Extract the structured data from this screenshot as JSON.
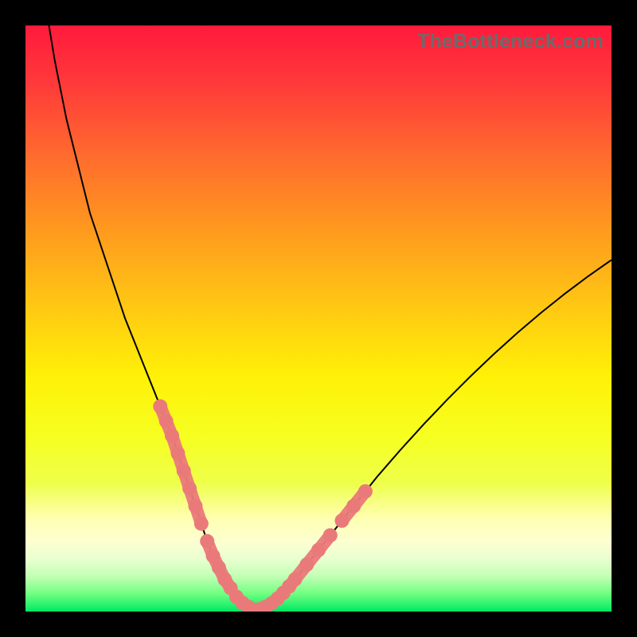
{
  "watermark_text": "TheBottleneck.com",
  "chart_data": {
    "type": "line",
    "title": "",
    "xlabel": "",
    "ylabel": "",
    "xlim": [
      0,
      100
    ],
    "ylim": [
      0,
      100
    ],
    "series": [
      {
        "name": "left_curve",
        "x": [
          4,
          5,
          6,
          7,
          8,
          9,
          10,
          11,
          12,
          13,
          14,
          15,
          16,
          17,
          18,
          19,
          20,
          21,
          22,
          23,
          24,
          25,
          26,
          27,
          28,
          29,
          30,
          31,
          32,
          33,
          34,
          35,
          36,
          37,
          38,
          39
        ],
        "y": [
          100,
          94,
          89,
          84,
          80,
          76,
          72,
          68,
          65,
          62,
          59,
          56,
          53,
          50,
          47.5,
          45,
          42.5,
          40,
          37.5,
          35,
          32.5,
          30,
          27,
          24,
          21,
          18,
          15,
          12,
          9.5,
          7.5,
          5.5,
          4,
          2.5,
          1.5,
          0.8,
          0.3
        ]
      },
      {
        "name": "right_curve",
        "x": [
          39,
          40,
          41,
          42,
          43,
          44,
          45,
          46,
          48,
          50,
          52,
          54,
          56,
          58,
          60,
          62,
          64,
          66,
          68,
          70,
          72,
          74,
          76,
          78,
          80,
          82,
          84,
          86,
          88,
          90,
          92,
          94,
          96,
          98,
          100
        ],
        "y": [
          0.3,
          0.4,
          0.8,
          1.4,
          2.2,
          3.2,
          4.3,
          5.5,
          8,
          10.5,
          13,
          15.5,
          18,
          20.5,
          23,
          25.3,
          27.6,
          29.8,
          32,
          34.1,
          36.2,
          38.2,
          40.2,
          42.1,
          44,
          45.8,
          47.6,
          49.3,
          51,
          52.6,
          54.2,
          55.7,
          57.2,
          58.6,
          60
        ]
      }
    ],
    "marker_segments": [
      {
        "name": "left_upper",
        "x": [
          23,
          24,
          25,
          26,
          27,
          28,
          29,
          30
        ],
        "y": [
          35,
          32.5,
          30,
          27,
          24,
          21,
          18,
          15
        ]
      },
      {
        "name": "left_middle",
        "x": [
          31,
          32,
          33,
          34,
          35
        ],
        "y": [
          12,
          9.5,
          7.5,
          5.5,
          4
        ]
      },
      {
        "name": "bottom",
        "x": [
          36,
          37,
          38,
          39,
          40,
          41,
          42,
          43,
          44
        ],
        "y": [
          2.5,
          1.5,
          0.8,
          0.3,
          0.4,
          0.8,
          1.4,
          2.2,
          3.2
        ]
      },
      {
        "name": "right_lower",
        "x": [
          45,
          46,
          48,
          50,
          52
        ],
        "y": [
          4.3,
          5.5,
          8,
          10.5,
          13
        ]
      },
      {
        "name": "right_upper",
        "x": [
          54,
          56,
          58
        ],
        "y": [
          15.5,
          18,
          20.5
        ]
      }
    ]
  }
}
